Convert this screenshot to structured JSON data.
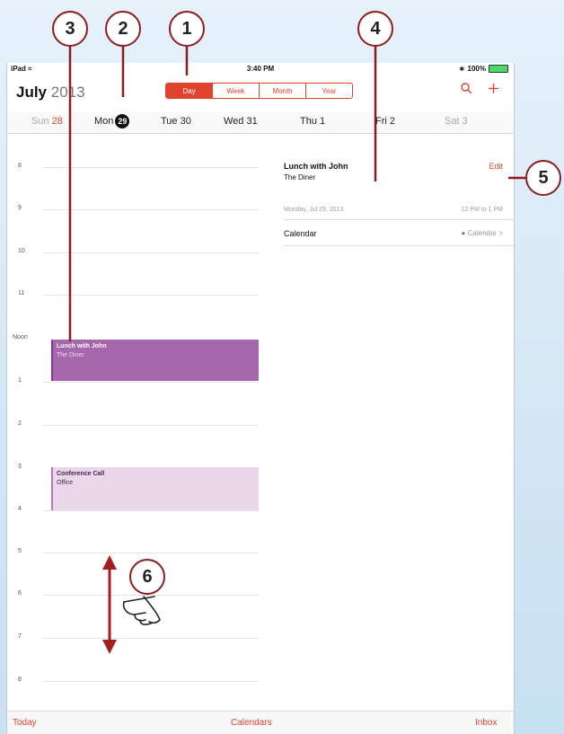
{
  "callouts": [
    "1",
    "2",
    "3",
    "4",
    "5",
    "6"
  ],
  "status_bar": {
    "device": "iPad",
    "time": "3:40 PM",
    "battery": "100%"
  },
  "header": {
    "month": "July",
    "year": "2013"
  },
  "view_segments": [
    {
      "label": "Day",
      "active": true
    },
    {
      "label": "Week",
      "active": false
    },
    {
      "label": "Month",
      "active": false
    },
    {
      "label": "Year",
      "active": false
    }
  ],
  "icons": {
    "search": "search-icon",
    "add": "plus-icon",
    "wifi": "wifi-icon",
    "bluetooth": "bluetooth-icon",
    "battery": "battery-icon",
    "gesture": "hand-swipe-icon"
  },
  "week_strip": {
    "sun": {
      "name": "Sun",
      "num": "28"
    },
    "mon": {
      "name": "Mon",
      "num": "29"
    },
    "tue": "Tue 30",
    "wed": "Wed 31",
    "thu": "Thu 1",
    "fri": "Fri 2",
    "sat": "Sat 3"
  },
  "hours": [
    "8",
    "9",
    "10",
    "11",
    "Noon",
    "1",
    "2",
    "3",
    "4",
    "5",
    "6",
    "7",
    "8"
  ],
  "events": [
    {
      "title": "Lunch with John",
      "location": "The Diner"
    },
    {
      "title": "Conference Call",
      "location": "Office"
    }
  ],
  "detail": {
    "title": "Lunch with John",
    "location": "The Diner",
    "edit_label": "Edit",
    "date": "Monday, Jul 29, 2013",
    "time": "12 PM to 1 PM",
    "calendar_label": "Calendar",
    "calendar_value": "Calendar"
  },
  "bottom_bar": {
    "today": "Today",
    "calendars": "Calendars",
    "inbox": "Inbox"
  },
  "colors": {
    "accent": "#e0442f",
    "event_primary": "#a667ad",
    "event_secondary": "#ead7ea",
    "callout_border": "#8c1d1d",
    "arrow": "#a31f1f"
  }
}
